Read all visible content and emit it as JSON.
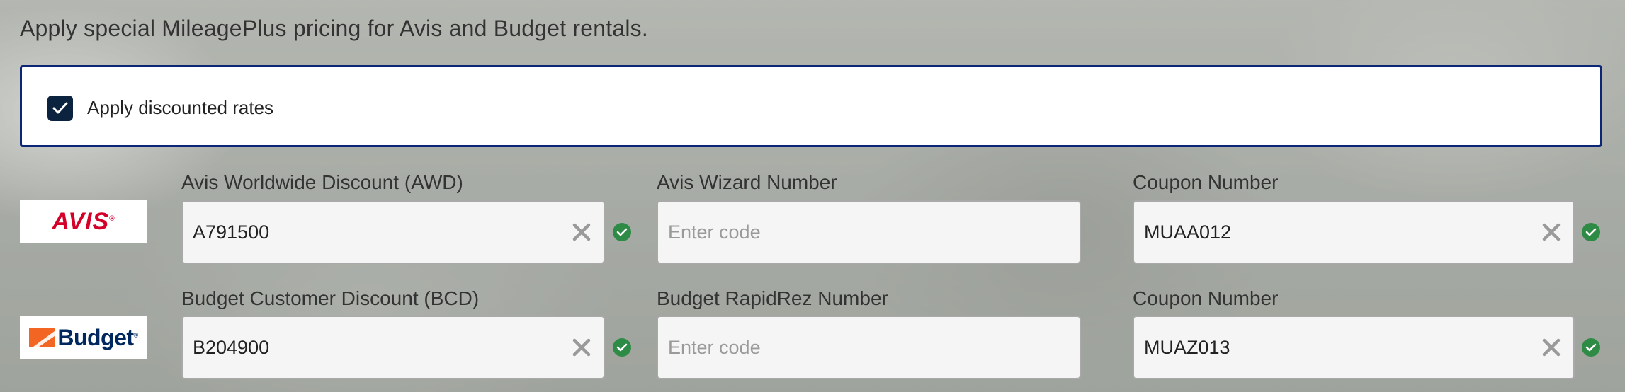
{
  "heading": "Apply special MileagePlus pricing for Avis and Budget rentals.",
  "discount_checkbox": {
    "label": "Apply discounted rates",
    "checked": true,
    "color": "#0c2340"
  },
  "panel_border_color": "#0c2577",
  "valid_color": "#2e8b45",
  "avis": {
    "logo_text": "AVIS",
    "logo_color": "#d4002a",
    "awd": {
      "label": "Avis Worldwide Discount (AWD)",
      "value": "A791500",
      "valid": true
    },
    "wizard": {
      "label": "Avis Wizard Number",
      "placeholder": "Enter code"
    },
    "coupon": {
      "label": "Coupon Number",
      "value": "MUAA012",
      "valid": true
    }
  },
  "budget": {
    "logo_text": "Budget",
    "logo_color": "#00285f",
    "logo_accent": "#f26522",
    "bcd": {
      "label": "Budget Customer Discount (BCD)",
      "value": "B204900",
      "valid": true
    },
    "rapidrez": {
      "label": "Budget RapidRez Number",
      "placeholder": "Enter code"
    },
    "coupon": {
      "label": "Coupon Number",
      "value": "MUAZ013",
      "valid": true
    }
  }
}
